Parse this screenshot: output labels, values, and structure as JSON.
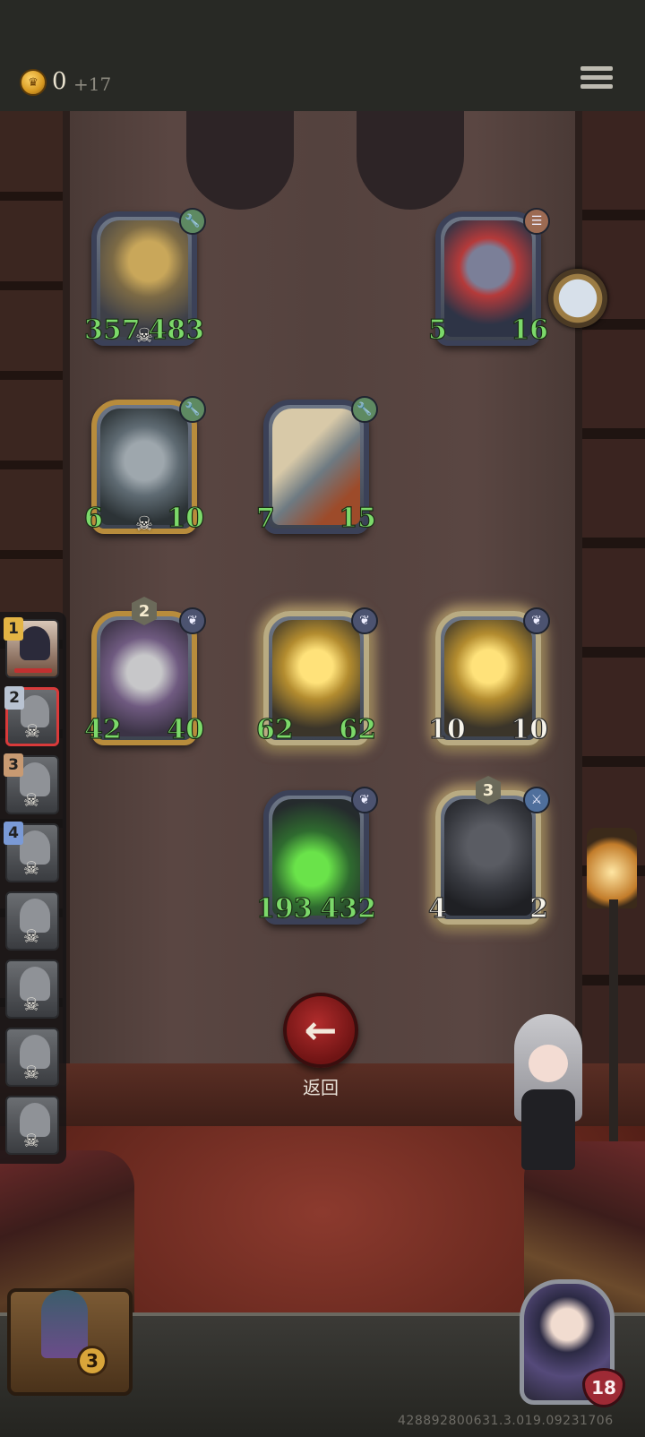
{
  "top_bar": {
    "gold": "0",
    "gold_income": "+17"
  },
  "board": [
    {
      "row": 1,
      "col": 1,
      "art": "robot",
      "type": "mech",
      "attack": "357",
      "health": "483",
      "stats_buffed": true,
      "has_skull": true,
      "tier": null,
      "frame": "silver"
    },
    {
      "row": 1,
      "col": 3,
      "art": "rat",
      "type": "beast",
      "attack": "5",
      "health": "16",
      "stats_buffed": true,
      "has_skull": false,
      "tier": null,
      "frame": "silver"
    },
    {
      "row": 2,
      "col": 1,
      "art": "bucket-robot",
      "type": "mech",
      "attack": "6",
      "health": "10",
      "stats_buffed": true,
      "has_skull": true,
      "tier": null,
      "frame": "gold"
    },
    {
      "row": 2,
      "col": 2,
      "art": "missile",
      "type": "mech",
      "attack": "7",
      "health": "15",
      "stats_buffed": true,
      "has_skull": false,
      "tier": null,
      "frame": "silver"
    },
    {
      "row": 3,
      "col": 1,
      "art": "dragon",
      "type": "dragon",
      "attack": "42",
      "health": "40",
      "stats_buffed": true,
      "has_skull": false,
      "tier": "2",
      "frame": "gold"
    },
    {
      "row": 3,
      "col": 2,
      "art": "sun-dragon",
      "type": "dragon",
      "attack": "62",
      "health": "62",
      "stats_buffed": true,
      "has_skull": false,
      "tier": null,
      "frame": "glow"
    },
    {
      "row": 3,
      "col": 3,
      "art": "sun-dragon",
      "type": "dragon",
      "attack": "10",
      "health": "10",
      "stats_buffed": false,
      "has_skull": false,
      "tier": null,
      "frame": "glow"
    },
    {
      "row": 4,
      "col": 2,
      "art": "slime-dragon",
      "type": "dragon",
      "attack": "193",
      "health": "432",
      "stats_buffed": true,
      "has_skull": false,
      "tier": null,
      "frame": "silver"
    },
    {
      "row": 4,
      "col": 3,
      "art": "knight",
      "type": "blade",
      "attack": "4",
      "health": "2",
      "stats_buffed": false,
      "has_skull": false,
      "tier": "3",
      "frame": "glow"
    }
  ],
  "party": [
    {
      "rank": "1",
      "rank_color": "#e3b444",
      "eliminated": false,
      "selected": false
    },
    {
      "rank": "2",
      "rank_color": "#b9c3d2",
      "eliminated": true,
      "selected": true
    },
    {
      "rank": "3",
      "rank_color": "#c89a72",
      "eliminated": true,
      "selected": false
    },
    {
      "rank": "4",
      "rank_color": "#7a9ad6",
      "eliminated": true,
      "selected": false
    },
    {
      "rank": "",
      "rank_color": "",
      "eliminated": true,
      "selected": false
    },
    {
      "rank": "",
      "rank_color": "",
      "eliminated": true,
      "selected": false
    },
    {
      "rank": "",
      "rank_color": "",
      "eliminated": true,
      "selected": false
    },
    {
      "rank": "",
      "rank_color": "",
      "eliminated": true,
      "selected": false
    }
  ],
  "back_button": {
    "label": "返回"
  },
  "bottom_bar": {
    "chest_count": "3",
    "player_health": "18",
    "build_id": "428892800631.3.019.09231706"
  },
  "colors": {
    "buffed_stat": "#7cd96a",
    "base_stat": "#f6f3ea",
    "attack_ring": "#3c6c95",
    "health_ring": "#a0302e"
  }
}
